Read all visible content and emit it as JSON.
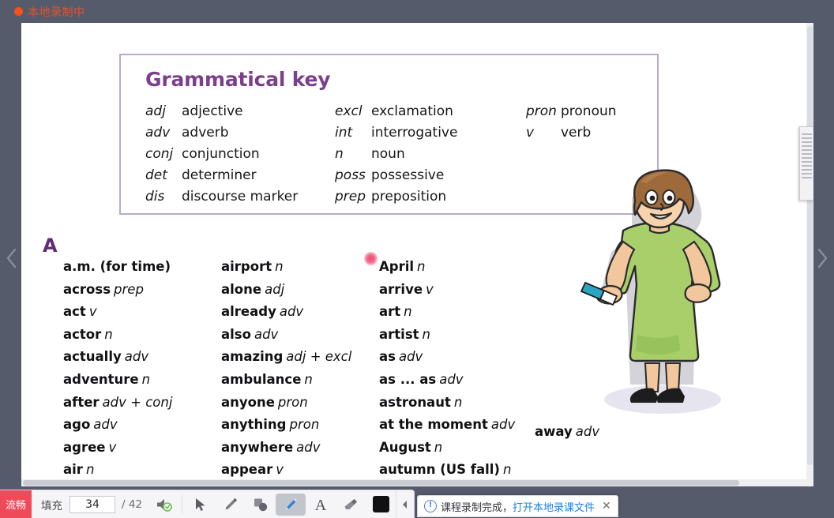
{
  "recording_bar": {
    "status_text": "本地录制中",
    "dot_color": "#f4511e",
    "text_color": "#e2542a"
  },
  "slide": {
    "grammatical_key": {
      "title": "Grammatical key",
      "title_color": "#7b3f8c",
      "border_color": "#b9aacb",
      "columns": [
        [
          {
            "abbr": "adj",
            "full": "adjective"
          },
          {
            "abbr": "adv",
            "full": "adverb"
          },
          {
            "abbr": "conj",
            "full": "conjunction"
          },
          {
            "abbr": "det",
            "full": "determiner"
          },
          {
            "abbr": "dis",
            "full": "discourse marker"
          }
        ],
        [
          {
            "abbr": "excl",
            "full": "exclamation"
          },
          {
            "abbr": "int",
            "full": "interrogative"
          },
          {
            "abbr": "n",
            "full": "noun"
          },
          {
            "abbr": "poss",
            "full": "possessive"
          },
          {
            "abbr": "prep",
            "full": "preposition"
          }
        ],
        [
          {
            "abbr": "pron",
            "full": "pronoun"
          },
          {
            "abbr": "v",
            "full": "verb"
          }
        ]
      ]
    },
    "letter_heading": "A",
    "letter_color": "#5e2d78",
    "word_columns": [
      [
        {
          "word": "a.m. (for time)",
          "pos": ""
        },
        {
          "word": "across",
          "pos": "prep"
        },
        {
          "word": "act",
          "pos": "v"
        },
        {
          "word": "actor",
          "pos": "n"
        },
        {
          "word": "actually",
          "pos": "adv"
        },
        {
          "word": "adventure",
          "pos": "n"
        },
        {
          "word": "after",
          "pos": "adv + conj"
        },
        {
          "word": "ago",
          "pos": "adv"
        },
        {
          "word": "agree",
          "pos": "v"
        },
        {
          "word": "air",
          "pos": "n"
        }
      ],
      [
        {
          "word": "airport",
          "pos": "n"
        },
        {
          "word": "alone",
          "pos": "adj"
        },
        {
          "word": "already",
          "pos": "adv"
        },
        {
          "word": "also",
          "pos": "adv"
        },
        {
          "word": "amazing",
          "pos": "adj + excl"
        },
        {
          "word": "ambulance",
          "pos": "n"
        },
        {
          "word": "anyone",
          "pos": "pron"
        },
        {
          "word": "anything",
          "pos": "pron"
        },
        {
          "word": "anywhere",
          "pos": "adv"
        },
        {
          "word": "appear",
          "pos": "v"
        }
      ],
      [
        {
          "word": "April",
          "pos": "n"
        },
        {
          "word": "arrive",
          "pos": "v"
        },
        {
          "word": "art",
          "pos": "n"
        },
        {
          "word": "artist",
          "pos": "n"
        },
        {
          "word": "as",
          "pos": "adv"
        },
        {
          "word": "as ... as",
          "pos": "adv"
        },
        {
          "word": "astronaut",
          "pos": "n"
        },
        {
          "word": "at the moment",
          "pos": "adv"
        },
        {
          "word": "August",
          "pos": "n"
        },
        {
          "word": "autumn (US fall)",
          "pos": "n"
        }
      ]
    ],
    "illustration_caption": {
      "word": "away",
      "pos": "adv"
    },
    "annotation_dot_color": "#f0527a"
  },
  "navigation": {
    "prev_label": "Previous page",
    "next_label": "Next page"
  },
  "toolbar": {
    "quality_badge": "流畅",
    "fill_label": "填充",
    "page_current": "34",
    "page_total": "/ 42",
    "tools": [
      {
        "name": "audio-icon",
        "label": "Audio",
        "active": false
      },
      {
        "name": "cursor-icon",
        "label": "Select",
        "active": false
      },
      {
        "name": "pen-icon",
        "label": "Pen",
        "active": false
      },
      {
        "name": "shape-icon",
        "label": "Shape",
        "active": false
      },
      {
        "name": "highlighter-icon",
        "label": "Highlighter",
        "active": true
      },
      {
        "name": "text-icon",
        "label": "Text",
        "active": false
      },
      {
        "name": "eraser-icon",
        "label": "Eraser",
        "active": false
      }
    ],
    "color_swatch": "#111114",
    "collapse_label": "Collapse toolbar"
  },
  "toast": {
    "icon": "info-icon",
    "text": "课程录制完成，",
    "link": "打开本地录课文件",
    "close": "✕"
  }
}
